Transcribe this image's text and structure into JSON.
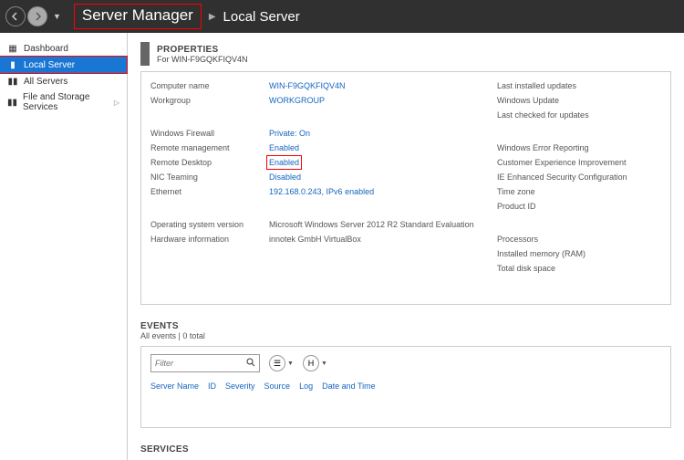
{
  "header": {
    "title": "Server Manager",
    "breadcrumb_sub": "Local Server"
  },
  "sidebar": {
    "items": [
      {
        "label": "Dashboard",
        "icon": "▦"
      },
      {
        "label": "Local Server",
        "icon": "▮"
      },
      {
        "label": "All Servers",
        "icon": "▮▮"
      },
      {
        "label": "File and Storage Services",
        "icon": "▮▮",
        "chevron": "▷"
      }
    ]
  },
  "properties": {
    "title": "PROPERTIES",
    "subtitle": "For WIN-F9GQKFIQV4N",
    "left": {
      "rows": [
        {
          "label": "Computer name",
          "value": "WIN-F9GQKFIQV4N"
        },
        {
          "label": "Workgroup",
          "value": "WORKGROUP"
        }
      ],
      "rows2": [
        {
          "label": "Windows Firewall",
          "value": "Private: On"
        },
        {
          "label": "Remote management",
          "value": "Enabled"
        },
        {
          "label": "Remote Desktop",
          "value": "Enabled",
          "highlight": true
        },
        {
          "label": "NIC Teaming",
          "value": "Disabled"
        },
        {
          "label": "Ethernet",
          "value": "192.168.0.243, IPv6 enabled"
        }
      ],
      "rows3": [
        {
          "label": "Operating system version",
          "value": "Microsoft Windows Server 2012 R2 Standard Evaluation"
        },
        {
          "label": "Hardware information",
          "value": "innotek GmbH VirtualBox"
        }
      ]
    },
    "right": {
      "rows": [
        {
          "label": "Last installed updates"
        },
        {
          "label": "Windows Update"
        },
        {
          "label": "Last checked for updates"
        }
      ],
      "rows2": [
        {
          "label": "Windows Error Reporting"
        },
        {
          "label": "Customer Experience Improvement"
        },
        {
          "label": "IE Enhanced Security Configuration"
        },
        {
          "label": "Time zone"
        },
        {
          "label": "Product ID"
        }
      ],
      "rows3": [
        {
          "label": "Processors"
        },
        {
          "label": "Installed memory (RAM)"
        },
        {
          "label": "Total disk space"
        }
      ]
    }
  },
  "events": {
    "title": "EVENTS",
    "subtitle": "All events | 0 total",
    "filter_placeholder": "Filter",
    "columns": [
      "Server Name",
      "ID",
      "Severity",
      "Source",
      "Log",
      "Date and Time"
    ]
  },
  "services": {
    "title": "SERVICES"
  }
}
